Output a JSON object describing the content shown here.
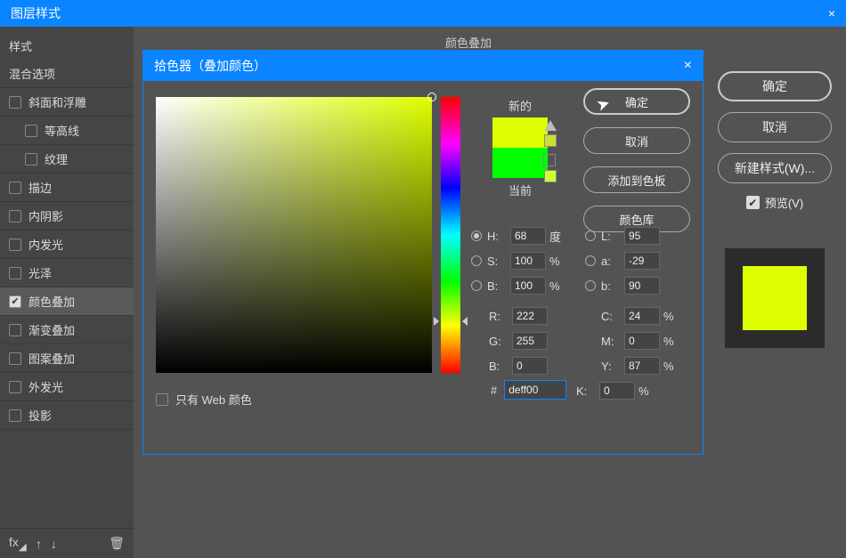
{
  "window": {
    "title": "图层样式",
    "close_x": "×"
  },
  "sidebar": {
    "header": "样式",
    "blend": "混合选项",
    "items": [
      {
        "label": "斜面和浮雕",
        "checked": false,
        "sub": false
      },
      {
        "label": "等高线",
        "checked": false,
        "sub": true
      },
      {
        "label": "纹理",
        "checked": false,
        "sub": true
      },
      {
        "label": "描边",
        "checked": false,
        "sub": false
      },
      {
        "label": "内阴影",
        "checked": false,
        "sub": false
      },
      {
        "label": "内发光",
        "checked": false,
        "sub": false
      },
      {
        "label": "光泽",
        "checked": false,
        "sub": false
      },
      {
        "label": "颜色叠加",
        "checked": true,
        "sub": false,
        "selected": true
      },
      {
        "label": "渐变叠加",
        "checked": false,
        "sub": false
      },
      {
        "label": "图案叠加",
        "checked": false,
        "sub": false
      },
      {
        "label": "外发光",
        "checked": false,
        "sub": false
      },
      {
        "label": "投影",
        "checked": false,
        "sub": false
      }
    ],
    "fx_label": "fx"
  },
  "section_title": "颜色叠加",
  "right": {
    "ok": "确定",
    "cancel": "取消",
    "newstyle": "新建样式(W)...",
    "preview": "预览(V)"
  },
  "picker": {
    "title": "拾色器（叠加颜色）",
    "close_x": "×",
    "new_label": "新的",
    "current_label": "当前",
    "ok": "确定",
    "cancel": "取消",
    "add_swatch": "添加到色板",
    "color_lib": "颜色库",
    "webonly": "只有 Web 颜色",
    "labels": {
      "h": "H:",
      "s": "S:",
      "b": "B:",
      "r": "R:",
      "g": "G:",
      "bl": "B:",
      "l": "L:",
      "a": "a:",
      "lb": "b:",
      "c": "C:",
      "m": "M:",
      "y": "Y:",
      "k": "K:",
      "deg": "度",
      "pct": "%",
      "hash": "#"
    },
    "values": {
      "h": "68",
      "s": "100",
      "b": "100",
      "r": "222",
      "g": "255",
      "bl": "0",
      "l": "95",
      "a": "-29",
      "lb": "90",
      "c": "24",
      "m": "0",
      "y": "87",
      "k": "0",
      "hex": "deff00"
    }
  }
}
